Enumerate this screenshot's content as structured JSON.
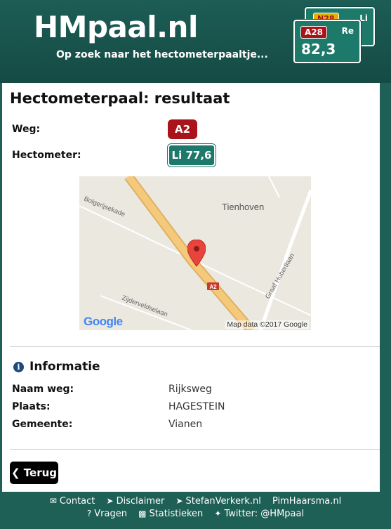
{
  "header": {
    "logo": "HMpaal.nl",
    "tagline": "Op zoek naar het hectometerpaaltje...",
    "sign_back": {
      "road": "N28",
      "side": "Li"
    },
    "sign_front": {
      "road": "A28",
      "side": "Re",
      "number": "82,3"
    }
  },
  "page": {
    "title": "Hectometerpaal: resultaat",
    "weg_label": "Weg:",
    "road": "A2",
    "hectometer_label": "Hectometer:",
    "hectometer": "Li 77,6"
  },
  "map": {
    "town": "Tienhoven",
    "streets": [
      "Bolgerijsekade",
      "Zijderveldselaan",
      "Graaf Hubertlaan"
    ],
    "road_shield": "A2",
    "google": "Google",
    "credit": "Map data ©2017 Google"
  },
  "info": {
    "title": "Informatie",
    "rows": [
      {
        "key": "Naam weg:",
        "value": "Rijksweg"
      },
      {
        "key": "Plaats:",
        "value": "HAGESTEIN"
      },
      {
        "key": "Gemeente:",
        "value": "Vianen"
      }
    ]
  },
  "back_button": "Terug",
  "footer": {
    "row1": [
      {
        "icon": "envelope-icon",
        "label": "Contact"
      },
      {
        "icon": "arrow-circle-icon",
        "label": "Disclaimer"
      },
      {
        "icon": "arrow-circle-icon",
        "label": "StefanVerkerk.nl"
      },
      {
        "icon": "",
        "label": "PimHaarsma.nl"
      }
    ],
    "row2": [
      {
        "icon": "question-icon",
        "label": "Vragen"
      },
      {
        "icon": "bar-chart-icon",
        "label": "Statistieken"
      },
      {
        "icon": "twitter-icon",
        "label": "Twitter: @HMpaal"
      }
    ]
  },
  "colors": {
    "header": "#1e5f56",
    "road_red": "#a8141a",
    "sign_green": "#1d7a6a"
  }
}
